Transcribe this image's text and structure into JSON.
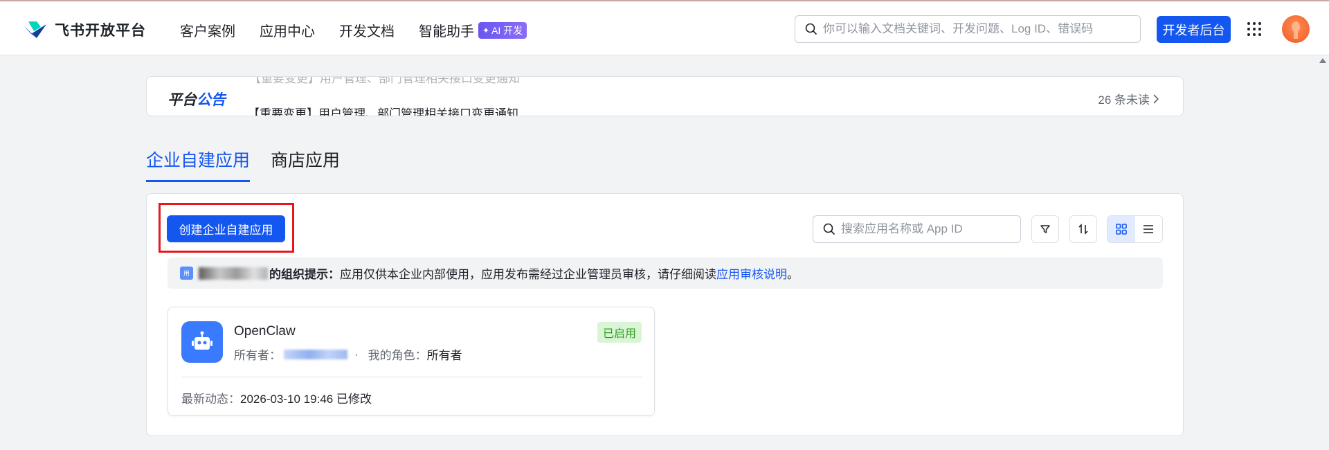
{
  "header": {
    "logo_text": "飞书开放平台",
    "nav": [
      "客户案例",
      "应用中心",
      "开发文档",
      "智能助手"
    ],
    "ai_badge": "AI 开发",
    "search_placeholder": "你可以输入文档关键词、开发问题、Log ID、错误码",
    "dev_console_label": "开发者后台"
  },
  "announcement": {
    "title_part1": "平台",
    "title_part2": "公告",
    "previous_item": "【重要变更】用户管理、部门管理相关接口变更通知",
    "current_item": "【重要变更】用户管理、部门管理相关接口变更通知",
    "unread_label": "26 条未读"
  },
  "tabs": [
    {
      "label": "企业自建应用",
      "active": true
    },
    {
      "label": "商店应用",
      "active": false
    }
  ],
  "toolbar": {
    "create_label": "创建企业自建应用",
    "search_placeholder": "搜索应用名称或 App ID"
  },
  "hint": {
    "icon_text": "用",
    "bold_suffix": "的组织提示：",
    "text": "应用仅供本企业内部使用，应用发布需经过企业管理员审核，请仔细阅读 ",
    "link": "应用审核说明",
    "end": "。"
  },
  "app_card": {
    "name": "OpenClaw",
    "status": "已启用",
    "owner_label": "所有者：",
    "separator": "·",
    "role_label": "我的角色：",
    "role_value": "所有者",
    "latest_label": "最新动态：",
    "latest_value": "2026-03-10 19:46 已修改"
  },
  "colors": {
    "primary": "#1456f0",
    "highlight_frame": "#e5171d",
    "status_green": "#2ea121"
  },
  "icons": [
    "search-icon",
    "grid-menu-icon",
    "filter-icon",
    "sort-icon",
    "card-view-icon",
    "list-view-icon",
    "robot-icon",
    "chevron-right-icon"
  ]
}
